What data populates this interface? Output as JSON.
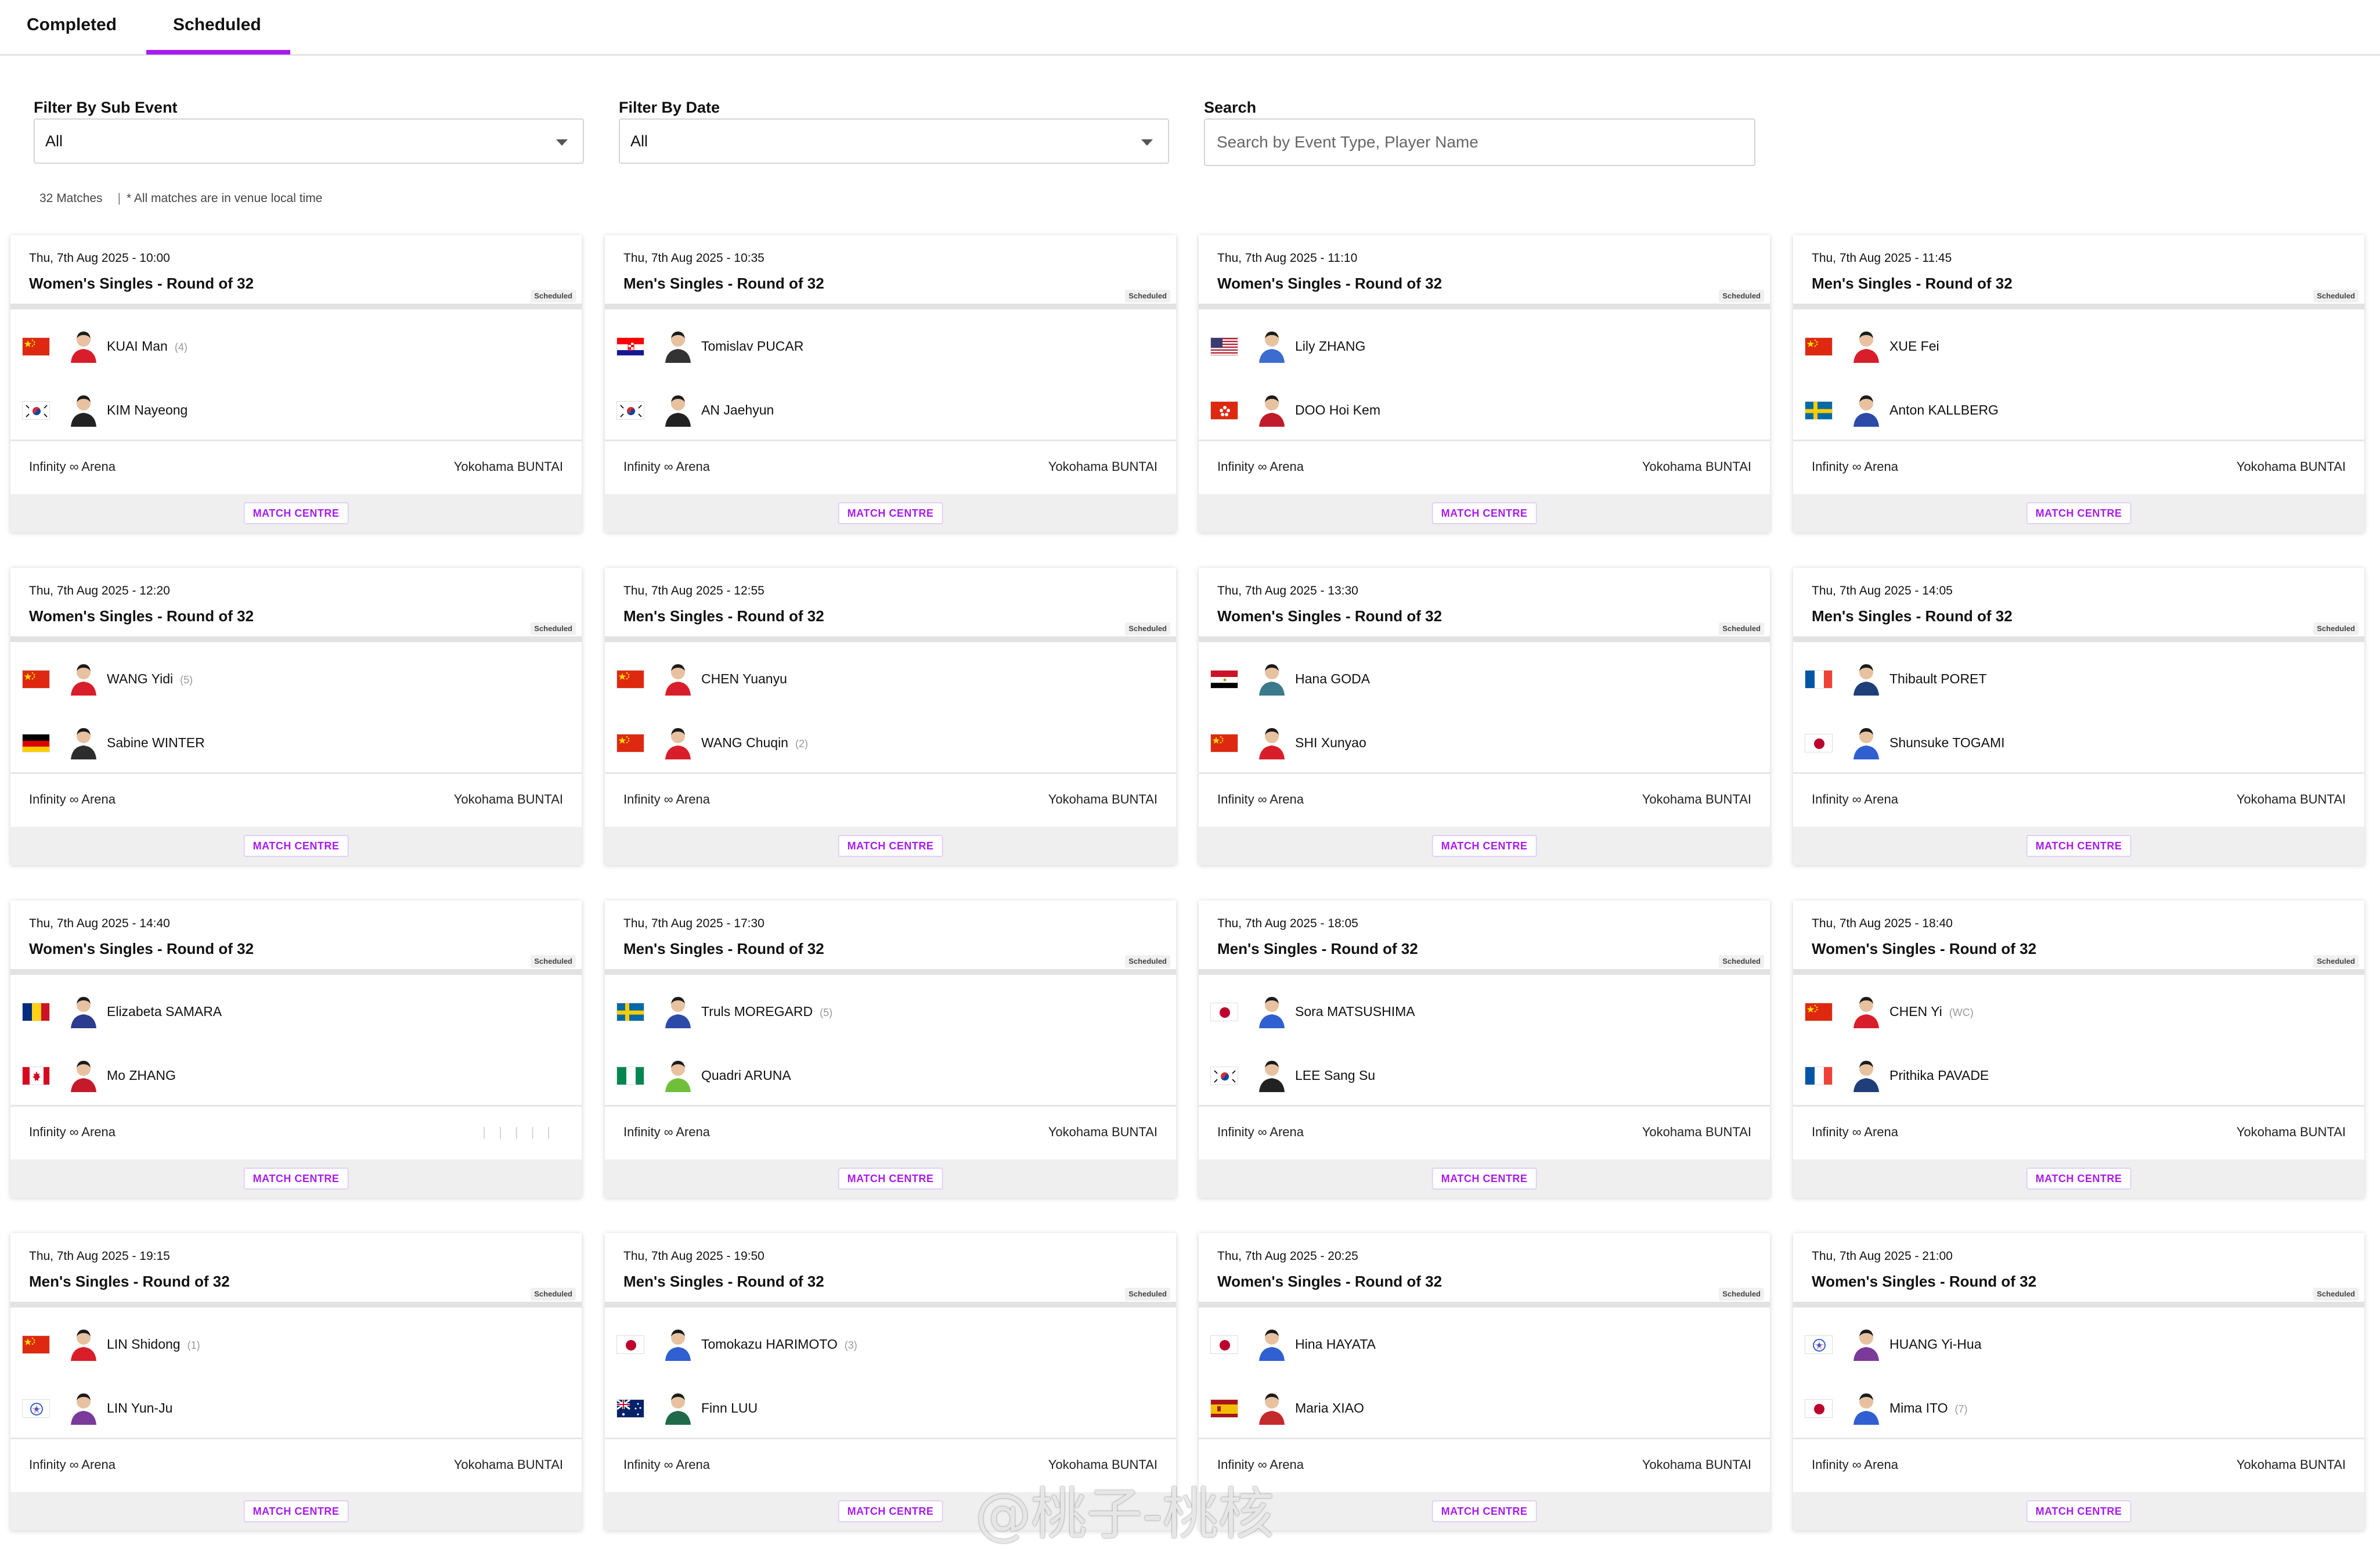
{
  "tabs": {
    "completed": "Completed",
    "scheduled": "Scheduled",
    "active": "Scheduled"
  },
  "filters": {
    "sub_event": {
      "label": "Filter By Sub Event",
      "value": "All"
    },
    "date": {
      "label": "Filter By Date",
      "value": "All"
    },
    "search": {
      "label": "Search",
      "placeholder": "Search by Event Type, Player Name",
      "value": ""
    }
  },
  "summary": {
    "count": "32 Matches",
    "note": "* All matches are in venue local time"
  },
  "badge_label": "Scheduled",
  "match_centre_label": "MATCH CENTRE",
  "accent_color": "#a81bf0",
  "matches": [
    {
      "datetime": "Thu, 7th Aug 2025 - 10:00",
      "event": "Women's Singles - Round of 32",
      "venue": "Infinity ∞ Arena",
      "court": "Yokohama BUNTAI",
      "p1": {
        "name": "KUAI Man",
        "seed": "(4)",
        "flag": "CHN"
      },
      "p2": {
        "name": "KIM Nayeong",
        "seed": "",
        "flag": "KOR"
      }
    },
    {
      "datetime": "Thu, 7th Aug 2025 - 10:35",
      "event": "Men's Singles - Round of 32",
      "venue": "Infinity ∞ Arena",
      "court": "Yokohama BUNTAI",
      "p1": {
        "name": "Tomislav PUCAR",
        "seed": "",
        "flag": "CRO"
      },
      "p2": {
        "name": "AN Jaehyun",
        "seed": "",
        "flag": "KOR"
      }
    },
    {
      "datetime": "Thu, 7th Aug 2025 - 11:10",
      "event": "Women's Singles - Round of 32",
      "venue": "Infinity ∞ Arena",
      "court": "Yokohama BUNTAI",
      "p1": {
        "name": "Lily ZHANG",
        "seed": "",
        "flag": "USA"
      },
      "p2": {
        "name": "DOO Hoi Kem",
        "seed": "",
        "flag": "HKG"
      }
    },
    {
      "datetime": "Thu, 7th Aug 2025 - 11:45",
      "event": "Men's Singles - Round of 32",
      "venue": "Infinity ∞ Arena",
      "court": "Yokohama BUNTAI",
      "p1": {
        "name": "XUE Fei",
        "seed": "",
        "flag": "CHN"
      },
      "p2": {
        "name": "Anton KALLBERG",
        "seed": "",
        "flag": "SWE"
      }
    },
    {
      "datetime": "Thu, 7th Aug 2025 - 12:20",
      "event": "Women's Singles - Round of 32",
      "venue": "Infinity ∞ Arena",
      "court": "Yokohama BUNTAI",
      "p1": {
        "name": "WANG Yidi",
        "seed": "(5)",
        "flag": "CHN"
      },
      "p2": {
        "name": "Sabine WINTER",
        "seed": "",
        "flag": "GER"
      }
    },
    {
      "datetime": "Thu, 7th Aug 2025 - 12:55",
      "event": "Men's Singles - Round of 32",
      "venue": "Infinity ∞ Arena",
      "court": "Yokohama BUNTAI",
      "p1": {
        "name": "CHEN Yuanyu",
        "seed": "",
        "flag": "CHN"
      },
      "p2": {
        "name": "WANG Chuqin",
        "seed": "(2)",
        "flag": "CHN"
      }
    },
    {
      "datetime": "Thu, 7th Aug 2025 - 13:30",
      "event": "Women's Singles - Round of 32",
      "venue": "Infinity ∞ Arena",
      "court": "Yokohama BUNTAI",
      "p1": {
        "name": "Hana GODA",
        "seed": "",
        "flag": "EGY"
      },
      "p2": {
        "name": "SHI Xunyao",
        "seed": "",
        "flag": "CHN"
      }
    },
    {
      "datetime": "Thu, 7th Aug 2025 - 14:05",
      "event": "Men's Singles - Round of 32",
      "venue": "Infinity ∞ Arena",
      "court": "Yokohama BUNTAI",
      "p1": {
        "name": "Thibault PORET",
        "seed": "",
        "flag": "FRA"
      },
      "p2": {
        "name": "Shunsuke TOGAMI",
        "seed": "",
        "flag": "JPN"
      }
    },
    {
      "datetime": "Thu, 7th Aug 2025 - 14:40",
      "event": "Women's Singles - Round of 32",
      "venue": "Infinity ∞ Arena",
      "court": "",
      "p1": {
        "name": "Elizabeta SAMARA",
        "seed": "",
        "flag": "ROU"
      },
      "p2": {
        "name": "Mo ZHANG",
        "seed": "",
        "flag": "CAN"
      }
    },
    {
      "datetime": "Thu, 7th Aug 2025 - 17:30",
      "event": "Men's Singles - Round of 32",
      "venue": "Infinity ∞ Arena",
      "court": "Yokohama BUNTAI",
      "p1": {
        "name": "Truls MOREGARD",
        "seed": "(5)",
        "flag": "SWE"
      },
      "p2": {
        "name": "Quadri ARUNA",
        "seed": "",
        "flag": "NGR"
      }
    },
    {
      "datetime": "Thu, 7th Aug 2025 - 18:05",
      "event": "Men's Singles - Round of 32",
      "venue": "Infinity ∞ Arena",
      "court": "Yokohama BUNTAI",
      "p1": {
        "name": "Sora MATSUSHIMA",
        "seed": "",
        "flag": "JPN"
      },
      "p2": {
        "name": "LEE Sang Su",
        "seed": "",
        "flag": "KOR"
      }
    },
    {
      "datetime": "Thu, 7th Aug 2025 - 18:40",
      "event": "Women's Singles - Round of 32",
      "venue": "Infinity ∞ Arena",
      "court": "Yokohama BUNTAI",
      "p1": {
        "name": "CHEN Yi",
        "seed": "(WC)",
        "flag": "CHN"
      },
      "p2": {
        "name": "Prithika PAVADE",
        "seed": "",
        "flag": "FRA"
      }
    },
    {
      "datetime": "Thu, 7th Aug 2025 - 19:15",
      "event": "Men's Singles - Round of 32",
      "venue": "Infinity ∞ Arena",
      "court": "Yokohama BUNTAI",
      "p1": {
        "name": "LIN Shidong",
        "seed": "(1)",
        "flag": "CHN"
      },
      "p2": {
        "name": "LIN Yun-Ju",
        "seed": "",
        "flag": "TPE"
      }
    },
    {
      "datetime": "Thu, 7th Aug 2025 - 19:50",
      "event": "Men's Singles - Round of 32",
      "venue": "Infinity ∞ Arena",
      "court": "Yokohama BUNTAI",
      "p1": {
        "name": "Tomokazu HARIMOTO",
        "seed": "(3)",
        "flag": "JPN"
      },
      "p2": {
        "name": "Finn LUU",
        "seed": "",
        "flag": "AUS"
      }
    },
    {
      "datetime": "Thu, 7th Aug 2025 - 20:25",
      "event": "Women's Singles - Round of 32",
      "venue": "Infinity ∞ Arena",
      "court": "Yokohama BUNTAI",
      "p1": {
        "name": "Hina HAYATA",
        "seed": "",
        "flag": "JPN"
      },
      "p2": {
        "name": "Maria XIAO",
        "seed": "",
        "flag": "ESP"
      }
    },
    {
      "datetime": "Thu, 7th Aug 2025 - 21:00",
      "event": "Women's Singles - Round of 32",
      "venue": "Infinity ∞ Arena",
      "court": "Yokohama BUNTAI",
      "p1": {
        "name": "HUANG Yi-Hua",
        "seed": "",
        "flag": "TPE"
      },
      "p2": {
        "name": "Mima ITO",
        "seed": "(7)",
        "flag": "JPN"
      }
    }
  ],
  "watermark": "@桃子-桃核"
}
